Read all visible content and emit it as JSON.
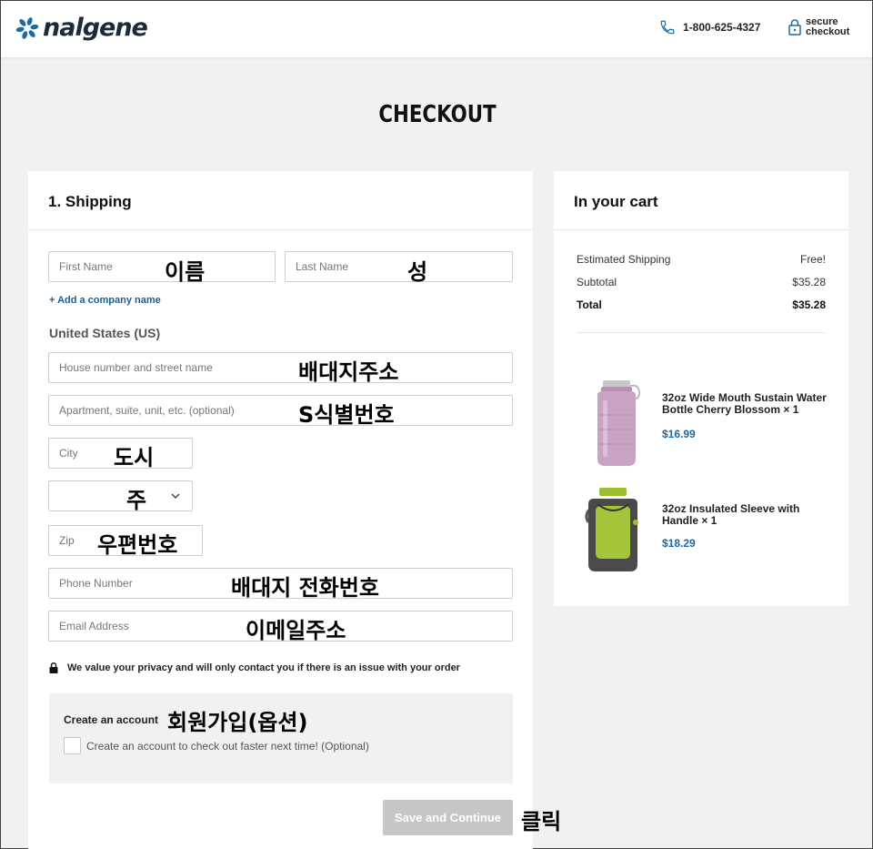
{
  "header": {
    "logo_text": "nalgene",
    "phone": "1-800-625-4327",
    "secure_label": "secure checkout"
  },
  "page_title": "CHECKOUT",
  "shipping": {
    "title": "1. Shipping",
    "first_name_placeholder": "First Name",
    "first_name_annotation": "이름",
    "last_name_placeholder": "Last Name",
    "last_name_annotation": "성",
    "add_company": "+ Add a company name",
    "country": "United States (US)",
    "street_placeholder": "House number and street name",
    "street_annotation": "배대지주소",
    "apt_placeholder": "Apartment, suite, unit, etc. (optional)",
    "apt_annotation": "S식별번호",
    "city_placeholder": "City",
    "city_annotation": "도시",
    "state_annotation": "주",
    "zip_placeholder": "Zip",
    "zip_annotation": "우편번호",
    "phone_placeholder": "Phone Number",
    "phone_annotation": "배대지 전화번호",
    "email_placeholder": "Email Address",
    "email_annotation": "이메일주소",
    "privacy_text": "We value your privacy and will only contact you if there is an issue with your order",
    "account_title": "Create an account",
    "account_annotation": "회원가입(옵션)",
    "account_checkbox_label": "Create an account to check out faster next time! (Optional)",
    "save_button": "Save and Continue",
    "save_annotation": "클릭"
  },
  "cart": {
    "title": "In your cart",
    "shipping_label": "Estimated Shipping",
    "shipping_value": "Free!",
    "subtotal_label": "Subtotal",
    "subtotal_value": "$35.28",
    "total_label": "Total",
    "total_value": "$35.28",
    "items": [
      {
        "name": "32oz Wide Mouth Sustain Water Bottle Cherry Blossom  × 1",
        "price": "$16.99"
      },
      {
        "name": "32oz Insulated Sleeve with Handle  × 1",
        "price": "$18.29"
      }
    ]
  },
  "colors": {
    "accent_blue": "#1b6aa5",
    "button_disabled": "#c6c6c6",
    "bottle_pink": "#c9a3c4",
    "sleeve_green": "#9bbf2e"
  }
}
